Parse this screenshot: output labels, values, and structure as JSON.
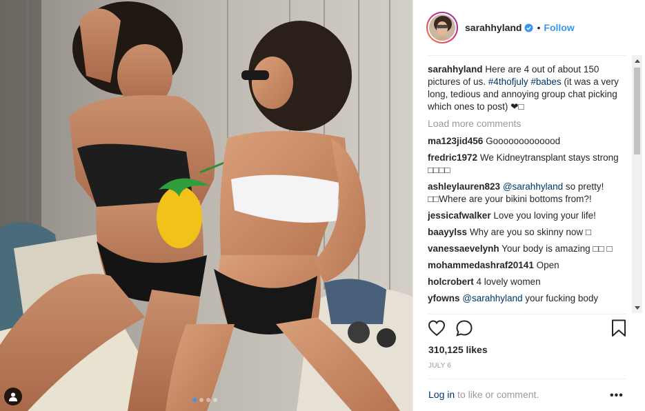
{
  "post": {
    "photo_alt": "Two women in swimwear on a sunny deck",
    "carousel": {
      "count": 4,
      "active_index": 0
    }
  },
  "header": {
    "username": "sarahhyland",
    "separator": "•",
    "follow_label": "Follow"
  },
  "caption": {
    "username": "sarahhyland",
    "text_parts": [
      "Here are 4 out of about 150 pictures of us. ",
      "#4thofjuly",
      " ",
      "#babes",
      " (it was a very long, tedious and annoying group chat picking which ones to post) ❤︎□"
    ]
  },
  "load_more_label": "Load more comments",
  "comments": [
    {
      "username": "ma123jid456",
      "text": "Gooooooooooood"
    },
    {
      "username": "fredric1972",
      "text": "We Kidneytransplant stays strong □□□□"
    },
    {
      "username": "ashleylauren823",
      "mention": "@sarahhyland",
      "text": " so pretty! □□Where are your bikini bottoms from?!"
    },
    {
      "username": "jessicafwalker",
      "text": "Love you loving your life!"
    },
    {
      "username": "baayylss",
      "text": "Why are you so skinny now □"
    },
    {
      "username": "vanessaevelynh",
      "text": "Your body is amazing □□ □"
    },
    {
      "username": "mohammedashraf20141",
      "text": "Open"
    },
    {
      "username": "holcrobert",
      "text": "4 lovely women"
    },
    {
      "username": "yfowns",
      "mention": "@sarahhyland",
      "text": " your fucking body"
    }
  ],
  "likes": "310,125 likes",
  "date": "JULY 6",
  "login_prompt": {
    "link": "Log in",
    "rest": " to like or comment."
  },
  "more_label": "•••",
  "colors": {
    "link_blue": "#3897f0",
    "hashtag": "#003569",
    "muted": "#999999"
  },
  "icons": [
    "heart-icon",
    "comment-icon",
    "bookmark-icon",
    "verified-badge-icon",
    "user-tag-icon"
  ]
}
